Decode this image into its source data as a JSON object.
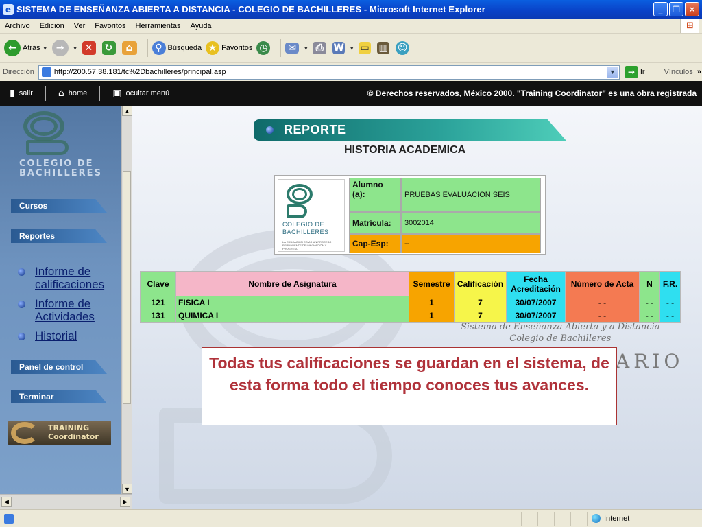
{
  "window": {
    "title": "SISTEMA DE ENSEÑANZA ABIERTA A DISTANCIA - COLEGIO DE BACHILLERES - Microsoft Internet Explorer"
  },
  "menu": [
    "Archivo",
    "Edición",
    "Ver",
    "Favoritos",
    "Herramientas",
    "Ayuda"
  ],
  "toolbar": {
    "back": "Atrás",
    "search": "Búsqueda",
    "favorites": "Favoritos"
  },
  "address": {
    "label": "Dirección",
    "url": "http://200.57.38.181/tc%2Dbachilleres/principal.asp",
    "go": "Ir",
    "links": "Vínculos"
  },
  "siteheader": {
    "exit": "salir",
    "home": "home",
    "hide_menu": "ocultar menú",
    "copyright": "© Derechos reservados, México 2000. \"Training Coordinator\" es una obra registrada"
  },
  "sidebar": {
    "logo_text_1": "COLEGIO DE",
    "logo_text_2": "BACHILLERES",
    "buttons": [
      "Cursos",
      "Reportes",
      "Panel de control",
      "Terminar"
    ],
    "links": [
      "Informe de calificaciones",
      "Informe de Actividades",
      "Historial"
    ],
    "training_1": "TRAINING",
    "training_2": "Coordinator"
  },
  "report": {
    "banner": "REPORTE",
    "subtitle": "HISTORIA ACADEMICA",
    "student": [
      {
        "key": "Alumno (a):",
        "value": "PRUEBAS EVALUACION SEIS"
      },
      {
        "key": "Matrícula:",
        "value": "3002014"
      },
      {
        "key": "Cap-Esp:",
        "value": "--"
      }
    ],
    "box_logo_1": "COLEGIO DE",
    "box_logo_2": "BACHILLERES",
    "box_logo_small": "LA EDUCACIÓN COMO UN PROCESO PERMANENTE DE INNOVACIÓN Y PROGRESO",
    "columns": [
      "Clave",
      "Nombre de Asignatura",
      "Semestre",
      "Calificación",
      "Fecha Acreditación",
      "Número de Acta",
      "N",
      "F.R."
    ],
    "rows": [
      [
        "121",
        "FISICA I",
        "1",
        "7",
        "30/07/2007",
        "- -",
        "- -",
        "- -"
      ],
      [
        "131",
        "QUIMICA I",
        "1",
        "7",
        "30/07/2007",
        "- -",
        "- -",
        "- -"
      ]
    ]
  },
  "background": {
    "watermark_1": "Sistema de Enseñanza Abierta y a Distancia",
    "watermark_2": "Colegio de Bachilleres",
    "watermark_3": "ARIO"
  },
  "callout": "Todas tus calificaciones se guardan en el sistema, de esta forma todo el tiempo conoces tus avances.",
  "status": {
    "zone": "Internet"
  }
}
